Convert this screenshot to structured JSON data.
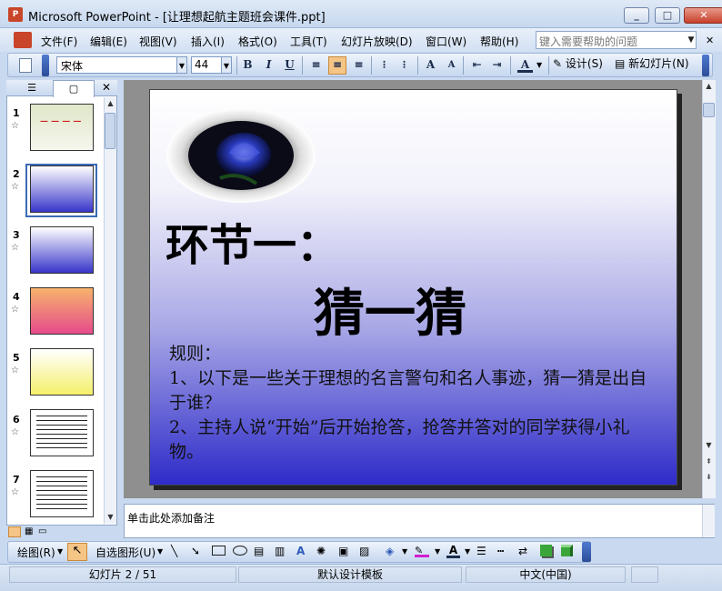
{
  "window": {
    "title": "Microsoft PowerPoint - [让理想起航主题班会课件.ppt]",
    "minimize": "_",
    "maximize": "□",
    "close": "✕"
  },
  "menu": {
    "items": [
      "文件(F)",
      "编辑(E)",
      "视图(V)",
      "插入(I)",
      "格式(O)",
      "工具(T)",
      "幻灯片放映(D)",
      "窗口(W)",
      "帮助(H)"
    ],
    "help_placeholder": "键入需要帮助的问题"
  },
  "toolbar": {
    "font_name": "宋体",
    "font_size": "44",
    "bold": "B",
    "italic": "I",
    "underline": "U",
    "design_label": "设计(S)",
    "new_slide_label": "新幻灯片(N)"
  },
  "pane": {
    "slide_numbers": [
      "1",
      "2",
      "3",
      "4",
      "5",
      "6",
      "7"
    ],
    "close": "✕"
  },
  "slide": {
    "title": "环节一：",
    "subtitle": "猜一猜",
    "body_lines": [
      "规则：",
      "1、以下是一些关于理想的名言警句和名人事迹，猜一猜是出自于谁？",
      "2、主持人说“开始”后开始抢答，抢答并答对的同学获得小礼物。"
    ]
  },
  "notes": {
    "placeholder": "单击此处添加备注"
  },
  "drawing_toolbar": {
    "draw_label": "绘图(R)",
    "autoshapes_label": "自选图形(U)"
  },
  "status": {
    "slide_position": "幻灯片 2 / 51",
    "template": "默认设计模板",
    "language": "中文(中国)"
  },
  "colors": {
    "slide_gradient_bottom": "#2e2bc9",
    "slide_gradient_top": "#ffffff",
    "selection": "#3c6ab6"
  }
}
